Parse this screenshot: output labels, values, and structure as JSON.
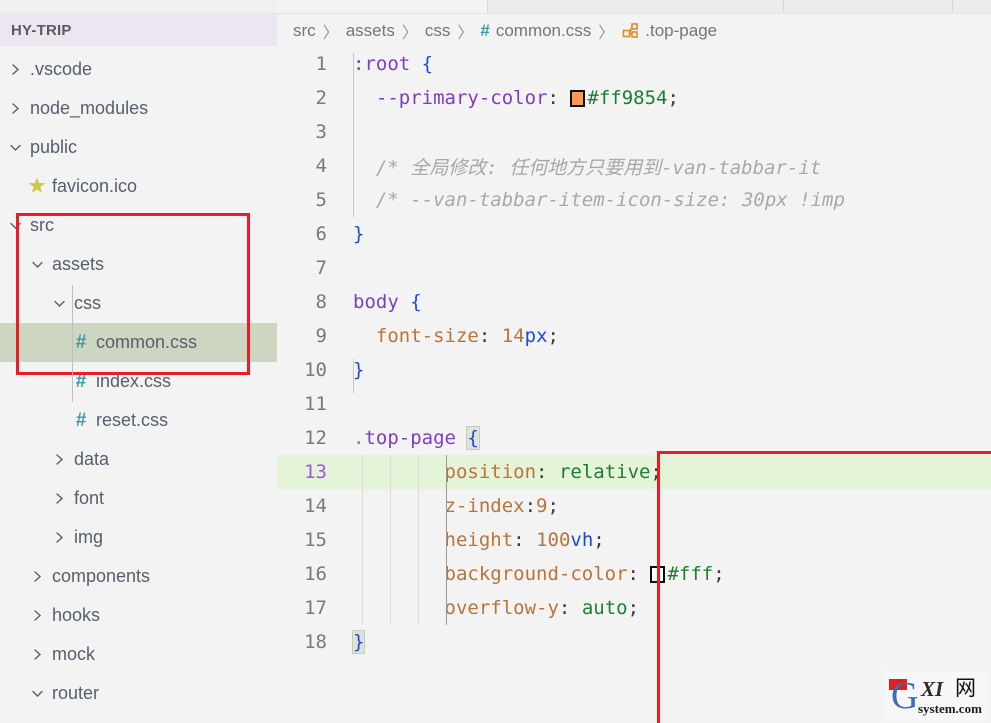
{
  "sidebar": {
    "title": "HY-TRIP",
    "items": [
      {
        "label": ".vscode",
        "icon": "chevron-right-icon",
        "indent": 0,
        "type": "folder",
        "expanded": false
      },
      {
        "label": "node_modules",
        "icon": "chevron-right-icon",
        "indent": 0,
        "type": "folder",
        "expanded": false
      },
      {
        "label": "public",
        "icon": "chevron-down-icon",
        "indent": 0,
        "type": "folder",
        "expanded": true
      },
      {
        "label": "favicon.ico",
        "icon": "star-icon",
        "indent": 1,
        "type": "file",
        "expanded": false
      },
      {
        "label": "src",
        "icon": "chevron-down-icon",
        "indent": 0,
        "type": "folder",
        "expanded": true
      },
      {
        "label": "assets",
        "icon": "chevron-down-icon",
        "indent": 1,
        "type": "folder",
        "expanded": true
      },
      {
        "label": "css",
        "icon": "chevron-down-icon",
        "indent": 2,
        "type": "folder",
        "expanded": true
      },
      {
        "label": "common.css",
        "icon": "hash-icon",
        "indent": 3,
        "type": "file",
        "expanded": false,
        "selected": true
      },
      {
        "label": "index.css",
        "icon": "hash-icon",
        "indent": 3,
        "type": "file",
        "expanded": false
      },
      {
        "label": "reset.css",
        "icon": "hash-icon",
        "indent": 3,
        "type": "file",
        "expanded": false
      },
      {
        "label": "data",
        "icon": "chevron-right-icon",
        "indent": 2,
        "type": "folder",
        "expanded": false
      },
      {
        "label": "font",
        "icon": "chevron-right-icon",
        "indent": 2,
        "type": "folder",
        "expanded": false
      },
      {
        "label": "img",
        "icon": "chevron-right-icon",
        "indent": 2,
        "type": "folder",
        "expanded": false
      },
      {
        "label": "components",
        "icon": "chevron-right-icon",
        "indent": 1,
        "type": "folder",
        "expanded": false
      },
      {
        "label": "hooks",
        "icon": "chevron-right-icon",
        "indent": 1,
        "type": "folder",
        "expanded": false
      },
      {
        "label": "mock",
        "icon": "chevron-right-icon",
        "indent": 1,
        "type": "folder",
        "expanded": false
      },
      {
        "label": "router",
        "icon": "chevron-down-icon",
        "indent": 1,
        "type": "folder",
        "expanded": true
      }
    ]
  },
  "breadcrumb": {
    "separator": "〉",
    "parts": [
      {
        "label": "src",
        "icon": null
      },
      {
        "label": "assets",
        "icon": null
      },
      {
        "label": "css",
        "icon": null
      },
      {
        "label": "common.css",
        "icon": "hash-icon"
      },
      {
        "label": ".top-page",
        "icon": "css-selector-icon"
      }
    ]
  },
  "editor": {
    "active_line": 13,
    "lines": [
      {
        "n": 1,
        "text": ":root {"
      },
      {
        "n": 2,
        "text": "  --primary-color: #ff9854;"
      },
      {
        "n": 3,
        "text": ""
      },
      {
        "n": 4,
        "text": "  /* 全局修改: 任何地方只要用到-van-tabbar-it"
      },
      {
        "n": 5,
        "text": "  /* --van-tabbar-item-icon-size: 30px !imp"
      },
      {
        "n": 6,
        "text": "}"
      },
      {
        "n": 7,
        "text": ""
      },
      {
        "n": 8,
        "text": "body {"
      },
      {
        "n": 9,
        "text": "  font-size: 14px;"
      },
      {
        "n": 10,
        "text": "}"
      },
      {
        "n": 11,
        "text": ""
      },
      {
        "n": 12,
        "text": ".top-page {"
      },
      {
        "n": 13,
        "text": "        position: relative;"
      },
      {
        "n": 14,
        "text": "        z-index:9;"
      },
      {
        "n": 15,
        "text": "        height: 100vh;"
      },
      {
        "n": 16,
        "text": "        background-color: #fff;"
      },
      {
        "n": 17,
        "text": "        overflow-y: auto;"
      },
      {
        "n": 18,
        "text": "}"
      }
    ],
    "tokens": {
      "l1_sel": ":root",
      "l1_brace": "{",
      "l2_var": "--primary-color",
      "l2_colon": ":",
      "l2_color": "#ff9854",
      "l2_semi": ";",
      "l4_comment": "/* 全局修改: 任何地方只要用到-van-tabbar-it",
      "l5_comment": "/* --van-tabbar-item-icon-size: 30px !imp",
      "l6_brace": "}",
      "l8_sel": "body",
      "l8_brace": "{",
      "l9_prop": "font-size",
      "l9_colon": ":",
      "l9_num": "14",
      "l9_unit": "px",
      "l9_semi": ";",
      "l10_brace": "}",
      "l12_sel": ".top-page",
      "l12_dot": ".",
      "l12_brace": "{",
      "l13_prop": "position",
      "l13_colon": ":",
      "l13_val": "relative",
      "l13_semi": ";",
      "l14_prop": "z-index",
      "l14_colon": ":",
      "l14_num": "9",
      "l14_semi": ";",
      "l15_prop": "height",
      "l15_colon": ":",
      "l15_num": "100",
      "l15_unit": "vh",
      "l15_semi": ";",
      "l16_prop": "background-color",
      "l16_colon": ":",
      "l16_val": "#fff",
      "l16_semi": ";",
      "l17_prop": "overflow-y",
      "l17_colon": ":",
      "l17_val": "auto",
      "l17_semi": ";",
      "l18_brace": "}"
    }
  },
  "colors": {
    "primary_swatch": "#ff9854",
    "white_swatch": "#ffffff",
    "annotation_red": "#ec1c24",
    "active_line_green": "#e5f3d8",
    "selected_row": "#ccd6c0",
    "sidebar_header_bg": "#ebe6f0",
    "hash_icon": "#3c99ab"
  },
  "watermark": {
    "g": "G",
    "xi": "XI",
    "cn": "网",
    "system": "system.com"
  }
}
